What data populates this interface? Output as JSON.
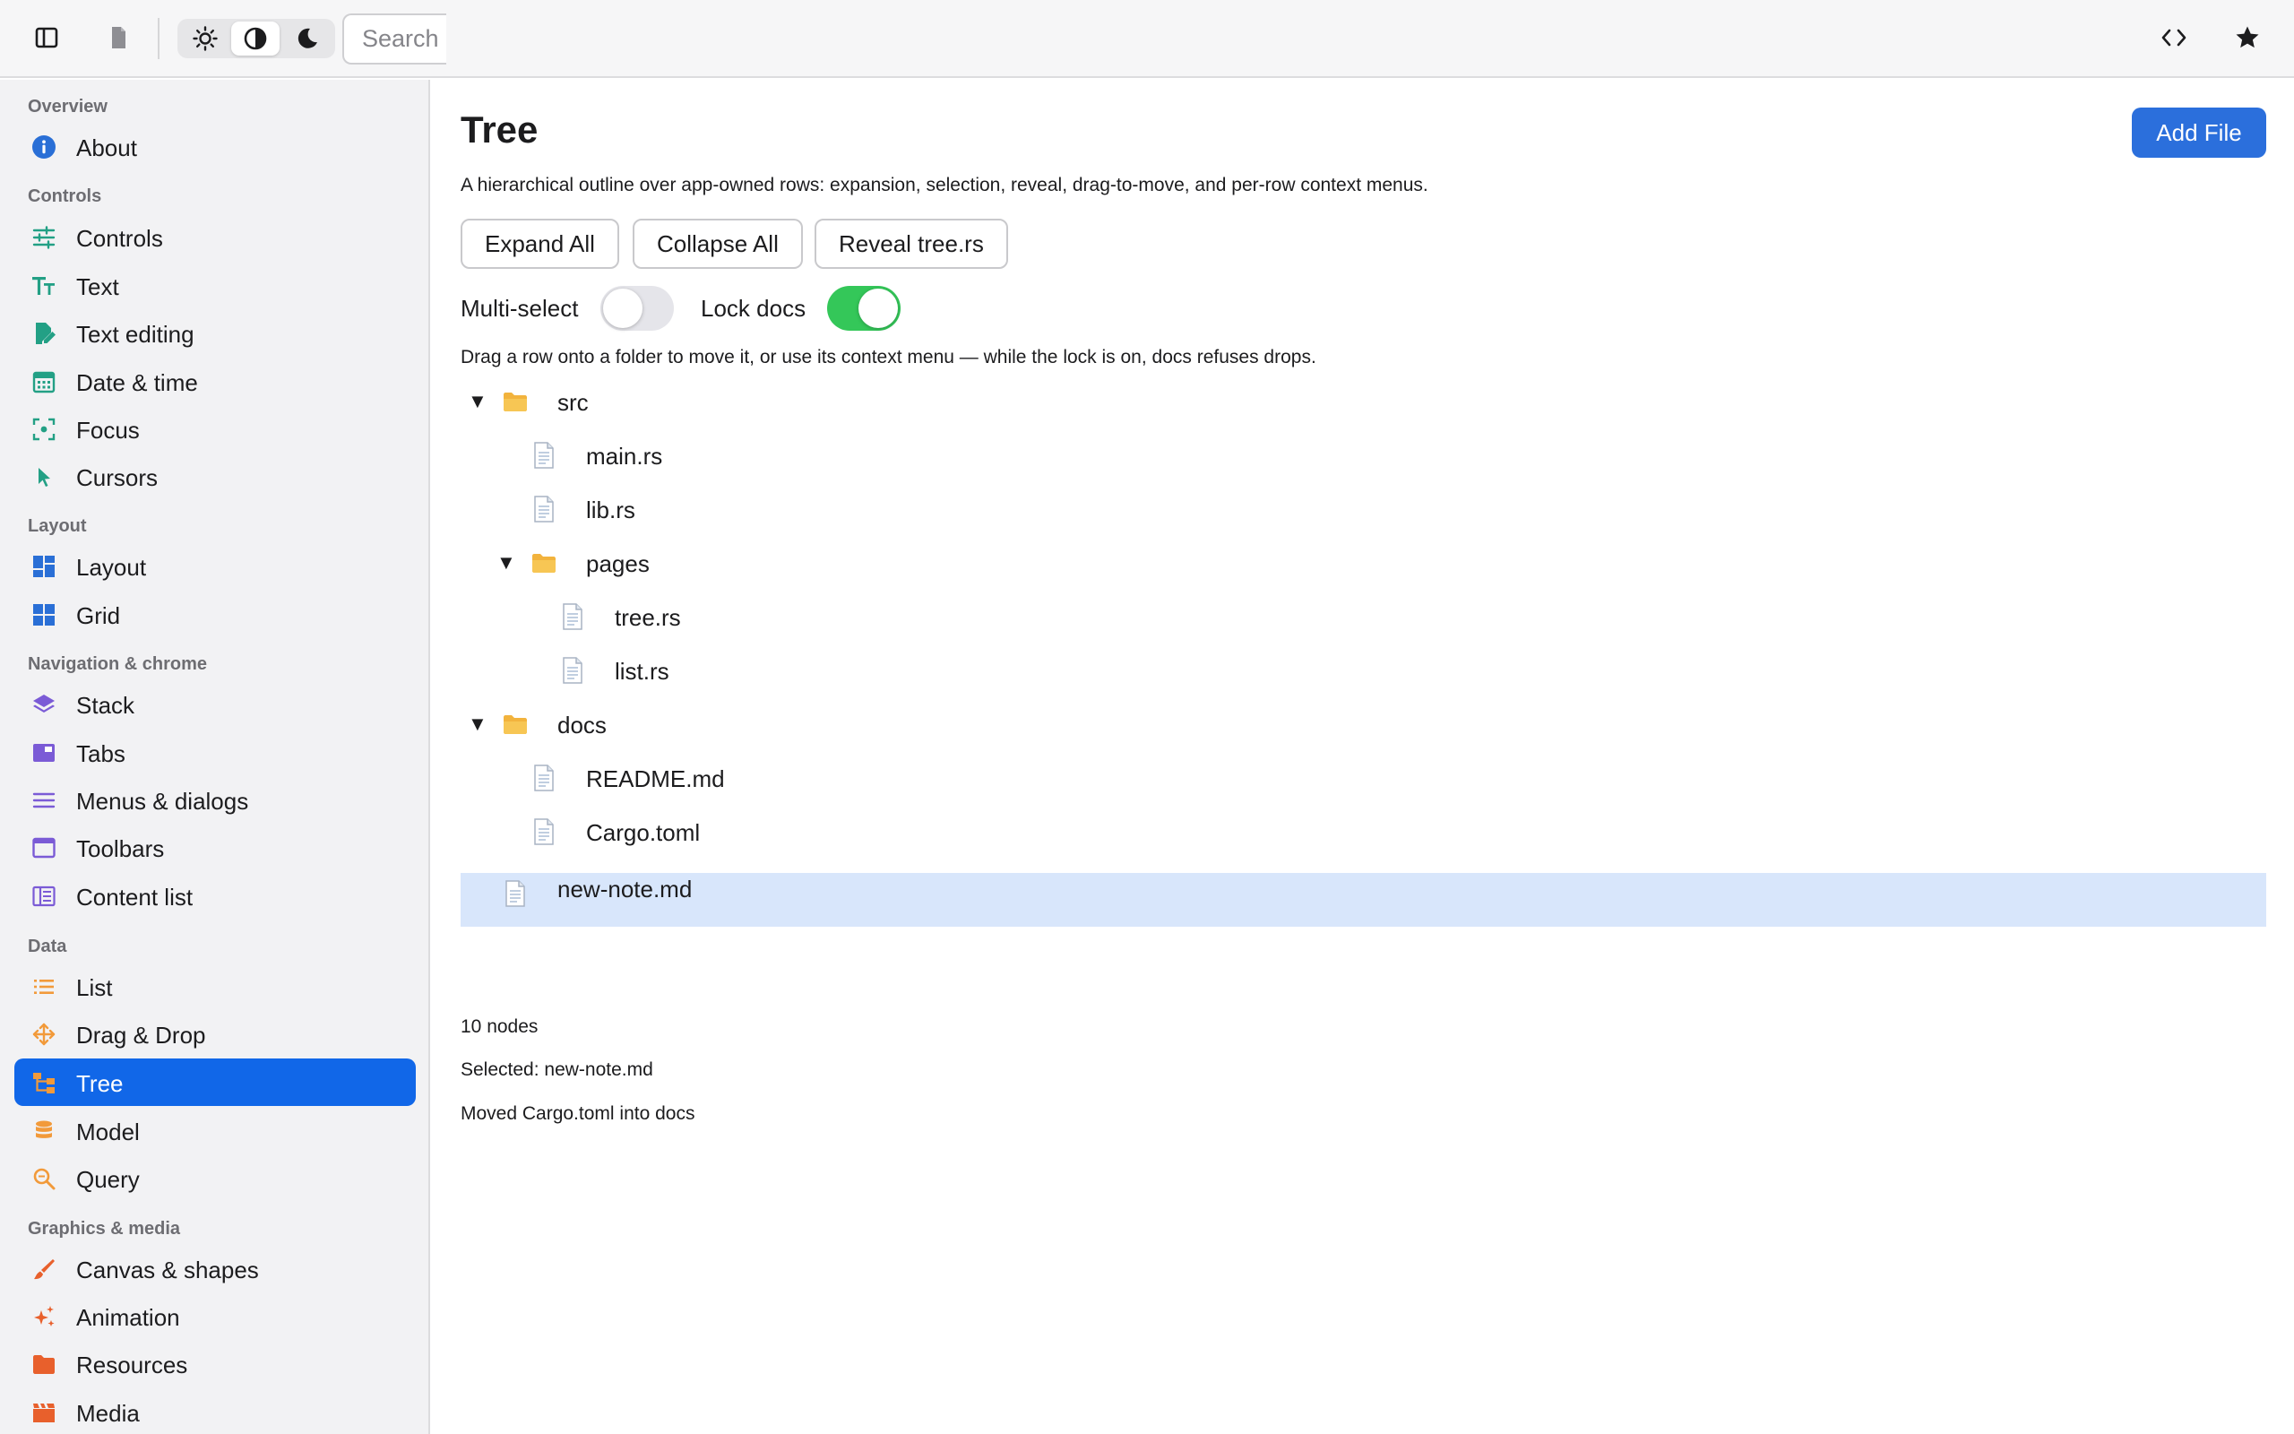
{
  "toolbar": {
    "search_placeholder": "Search",
    "theme_options": [
      "light",
      "auto",
      "dark"
    ],
    "active_theme": "auto"
  },
  "sidebar": {
    "sections": [
      {
        "title": "Overview",
        "items": [
          {
            "label": "About",
            "icon": "info-icon"
          }
        ]
      },
      {
        "title": "Controls",
        "items": [
          {
            "label": "Controls",
            "icon": "sliders-icon"
          },
          {
            "label": "Text",
            "icon": "text-size-icon"
          },
          {
            "label": "Text editing",
            "icon": "edit-document-icon"
          },
          {
            "label": "Date & time",
            "icon": "calendar-icon"
          },
          {
            "label": "Focus",
            "icon": "focus-icon"
          },
          {
            "label": "Cursors",
            "icon": "cursor-icon"
          }
        ]
      },
      {
        "title": "Layout",
        "items": [
          {
            "label": "Layout",
            "icon": "layout-icon"
          },
          {
            "label": "Grid",
            "icon": "grid-icon"
          }
        ]
      },
      {
        "title": "Navigation & chrome",
        "items": [
          {
            "label": "Stack",
            "icon": "stack-icon"
          },
          {
            "label": "Tabs",
            "icon": "tabs-icon"
          },
          {
            "label": "Menus & dialogs",
            "icon": "menu-icon"
          },
          {
            "label": "Toolbars",
            "icon": "toolbar-icon"
          },
          {
            "label": "Content list",
            "icon": "content-list-icon"
          }
        ]
      },
      {
        "title": "Data",
        "items": [
          {
            "label": "List",
            "icon": "list-icon"
          },
          {
            "label": "Drag & Drop",
            "icon": "move-icon"
          },
          {
            "label": "Tree",
            "icon": "tree-icon",
            "active": true
          },
          {
            "label": "Model",
            "icon": "database-icon"
          },
          {
            "label": "Query",
            "icon": "query-icon"
          }
        ]
      },
      {
        "title": "Graphics & media",
        "items": [
          {
            "label": "Canvas & shapes",
            "icon": "brush-icon"
          },
          {
            "label": "Animation",
            "icon": "sparkle-icon"
          },
          {
            "label": "Resources",
            "icon": "folder-icon"
          },
          {
            "label": "Media",
            "icon": "film-icon"
          }
        ]
      }
    ]
  },
  "main": {
    "title": "Tree",
    "add_button": "Add File",
    "description": "A hierarchical outline over app-owned rows: expansion, selection, reveal, drag-to-move, and per-row context menus.",
    "actions": {
      "expand": "Expand All",
      "collapse": "Collapse All",
      "reveal": "Reveal tree.rs"
    },
    "toggles": {
      "multi_select": {
        "label": "Multi-select",
        "on": false
      },
      "lock_docs": {
        "label": "Lock docs",
        "on": true
      }
    },
    "hint": "Drag a row onto a folder to move it, or use its context menu — while the lock is on, docs refuses drops.",
    "tree": [
      {
        "label": "src",
        "type": "folder",
        "depth": 0,
        "expanded": true
      },
      {
        "label": "main.rs",
        "type": "file",
        "depth": 1
      },
      {
        "label": "lib.rs",
        "type": "file",
        "depth": 1
      },
      {
        "label": "pages",
        "type": "folder",
        "depth": 1,
        "expanded": true
      },
      {
        "label": "tree.rs",
        "type": "file",
        "depth": 2
      },
      {
        "label": "list.rs",
        "type": "file",
        "depth": 2
      },
      {
        "label": "docs",
        "type": "folder",
        "depth": 0,
        "expanded": true
      },
      {
        "label": "README.md",
        "type": "file",
        "depth": 1
      },
      {
        "label": "Cargo.toml",
        "type": "file",
        "depth": 1
      },
      {
        "label": "new-note.md",
        "type": "file",
        "depth": 0,
        "selected": true
      }
    ],
    "status": {
      "count": "10 nodes",
      "selected": "Selected: new-note.md",
      "last_action": "Moved Cargo.toml into docs"
    }
  },
  "colors": {
    "accent": "#1167e8",
    "primary_button": "#2b6fdc",
    "toggle_on": "#34c759",
    "selection": "#d8e6fb",
    "icon_teal": "#23a085",
    "icon_blue": "#2a6fd6",
    "icon_purple": "#7b5bd6",
    "icon_orange": "#f29a3a",
    "icon_red_orange": "#e8602c"
  }
}
